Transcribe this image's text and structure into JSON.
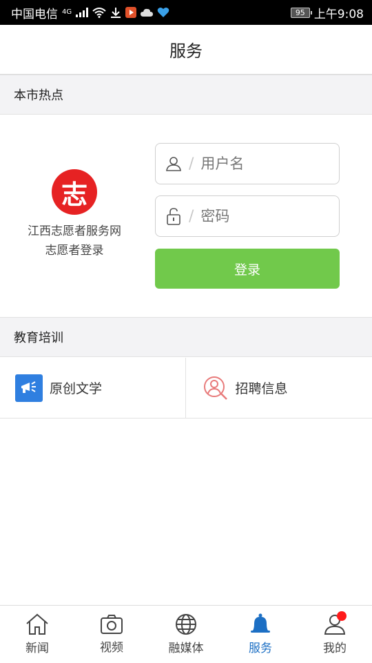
{
  "status_bar": {
    "carrier": "中国电信",
    "network": "4G",
    "battery": "95",
    "time": "上午9:08"
  },
  "header": {
    "title": "服务"
  },
  "sections": {
    "hot": "本市热点",
    "training": "教育培训"
  },
  "login": {
    "site_name": "江西志愿者服务网",
    "subtitle": "志愿者登录",
    "logo_char": "志",
    "username_placeholder": "用户名",
    "password_placeholder": "密码",
    "submit_label": "登录",
    "button_color": "#71c94b"
  },
  "tiles": [
    {
      "label": "原创文学",
      "icon": "megaphone-icon"
    },
    {
      "label": "招聘信息",
      "icon": "person-search-icon"
    }
  ],
  "tabbar": {
    "active_color": "#1c6fc4",
    "items": [
      {
        "label": "新闻",
        "icon": "home-icon"
      },
      {
        "label": "视频",
        "icon": "camera-icon"
      },
      {
        "label": "融媒体",
        "icon": "globe-icon"
      },
      {
        "label": "服务",
        "icon": "bell-icon",
        "active": true
      },
      {
        "label": "我的",
        "icon": "user-icon",
        "badge": true
      }
    ]
  }
}
